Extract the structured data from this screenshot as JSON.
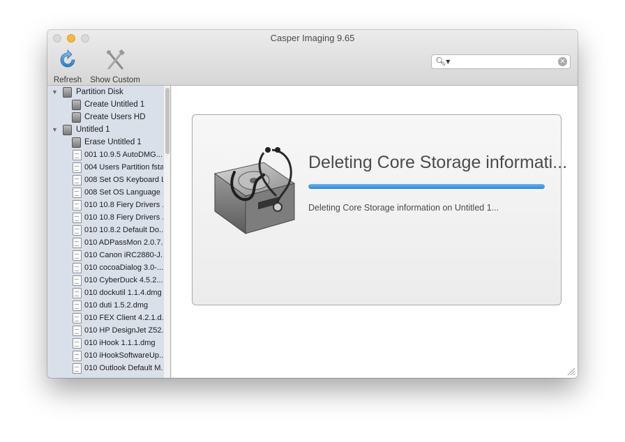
{
  "window": {
    "title": "Casper Imaging 9.65"
  },
  "toolbar": {
    "refresh_label": "Refresh",
    "show_custom_label": "Show Custom",
    "refresh_icon": "refresh-icon",
    "custom_icon": "tools-icon"
  },
  "search": {
    "value": "",
    "placeholder": ""
  },
  "sidebar": {
    "items": [
      {
        "label": "Partition Disk",
        "type": "group",
        "icon": "gear-disk-icon",
        "expanded": true
      },
      {
        "label": "Create Untitled 1",
        "type": "disk",
        "icon": "disk-icon"
      },
      {
        "label": "Create Users HD",
        "type": "disk",
        "icon": "disk-icon"
      },
      {
        "label": "Untitled 1",
        "type": "group",
        "icon": "disk-icon",
        "expanded": true
      },
      {
        "label": "Erase Untitled 1",
        "type": "disk",
        "icon": "disk-icon"
      },
      {
        "label": "001 10.9.5 AutoDMG....",
        "type": "doc",
        "icon": "document-icon"
      },
      {
        "label": "004 Users Partition fsta...",
        "type": "doc",
        "icon": "document-icon"
      },
      {
        "label": "008 Set OS Keyboard L...",
        "type": "doc",
        "icon": "document-icon"
      },
      {
        "label": "008 Set OS Language ...",
        "type": "doc",
        "icon": "document-icon"
      },
      {
        "label": "010 10.8 Fiery Drivers ...",
        "type": "doc",
        "icon": "document-icon"
      },
      {
        "label": "010 10.8 Fiery Drivers ...",
        "type": "doc",
        "icon": "document-icon"
      },
      {
        "label": "010 10.8.2 Default Do...",
        "type": "doc",
        "icon": "document-icon"
      },
      {
        "label": "010 ADPassMon 2.0.7....",
        "type": "doc",
        "icon": "document-icon"
      },
      {
        "label": "010 Canon iRC2880-J...",
        "type": "doc",
        "icon": "document-icon"
      },
      {
        "label": "010 cocoaDialog 3.0-...",
        "type": "doc",
        "icon": "document-icon"
      },
      {
        "label": "010 CyberDuck 4.5.2....",
        "type": "doc",
        "icon": "document-icon"
      },
      {
        "label": "010 dockutil 1.1.4.dmg",
        "type": "doc",
        "icon": "document-icon"
      },
      {
        "label": "010 duti 1.5.2.dmg",
        "type": "doc",
        "icon": "document-icon"
      },
      {
        "label": "010 FEX Client 4.2.1.d...",
        "type": "doc",
        "icon": "document-icon"
      },
      {
        "label": "010 HP DesignJet Z52...",
        "type": "doc",
        "icon": "document-icon"
      },
      {
        "label": "010 iHook 1.1.1.dmg",
        "type": "doc",
        "icon": "document-icon"
      },
      {
        "label": "010 iHookSoftwareUp...",
        "type": "doc",
        "icon": "document-icon"
      },
      {
        "label": "010 Outlook Default M...",
        "type": "doc",
        "icon": "document-icon"
      }
    ]
  },
  "progress": {
    "title": "Deleting Core Storage informati...",
    "detail": "Deleting Core Storage information on Untitled 1...",
    "fraction": 1.0,
    "icon": "disk-utility-stethoscope-icon"
  },
  "colors": {
    "accent": "#2f86d8",
    "sidebar_bg": "#d9e0ea"
  }
}
